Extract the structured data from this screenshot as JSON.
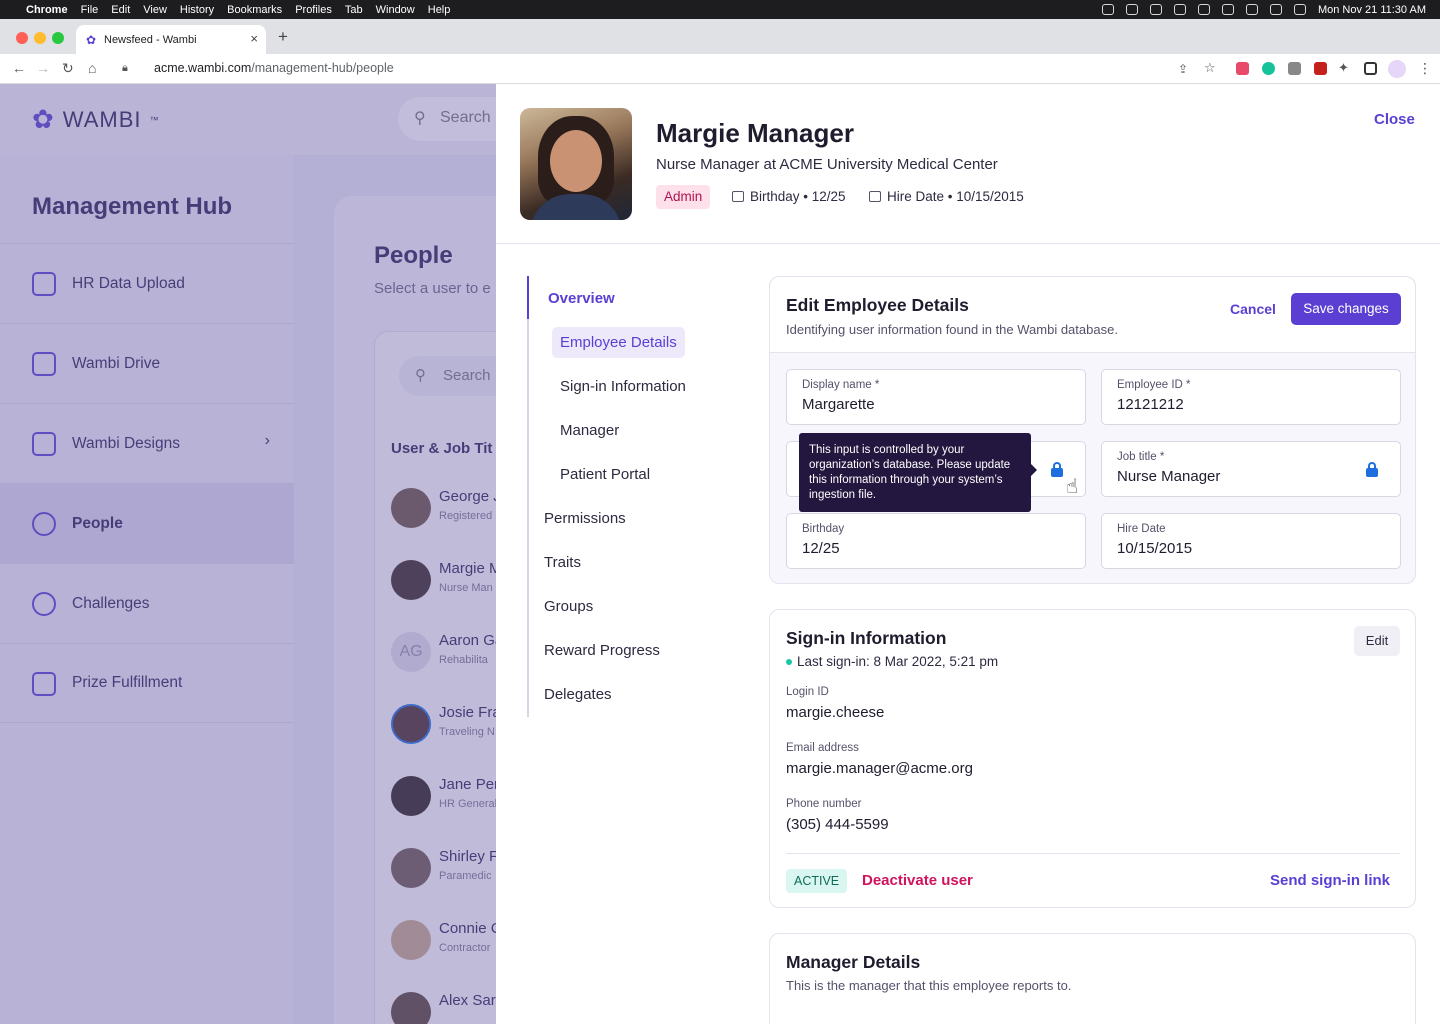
{
  "menubar": {
    "apple": "",
    "items": [
      "Chrome",
      "File",
      "Edit",
      "View",
      "History",
      "Bookmarks",
      "Profiles",
      "Tab",
      "Window",
      "Help"
    ],
    "datetime": "Mon Nov 21  11:30 AM"
  },
  "browser": {
    "tab_title": "Newsfeed - Wambi",
    "url_host": "acme.wambi.com",
    "url_path": "/management-hub/people"
  },
  "app": {
    "logo": "WAMBI",
    "logo_tm": "™",
    "search_placeholder": "Search",
    "sidebar": {
      "title": "Management Hub",
      "items": [
        {
          "label": "HR Data Upload",
          "icon": "upload-file-icon"
        },
        {
          "label": "Wambi Drive",
          "icon": "folder-icon"
        },
        {
          "label": "Wambi Designs",
          "icon": "image-icon"
        },
        {
          "label": "People",
          "icon": "user-add-icon"
        },
        {
          "label": "Challenges",
          "icon": "badge-icon"
        },
        {
          "label": "Prize Fulfillment",
          "icon": "gift-icon"
        }
      ]
    },
    "people": {
      "title": "People",
      "subtitle": "Select a user to e",
      "list_search": "Search",
      "column_header": "User & Job Tit",
      "rows": [
        {
          "name": "George J",
          "job": "Registered"
        },
        {
          "name": "Margie M",
          "job": "Nurse Man"
        },
        {
          "name": "Aaron Ga",
          "job": "Rehabilita",
          "initials": "AG"
        },
        {
          "name": "Josie Fra",
          "job": "Traveling N"
        },
        {
          "name": "Jane Per",
          "job": "HR General"
        },
        {
          "name": "Shirley F",
          "job": "Paramedic"
        },
        {
          "name": "Connie C",
          "job": "Contractor"
        },
        {
          "name": "Alex Sar",
          "job": ""
        }
      ]
    }
  },
  "panel": {
    "name": "Margie Manager",
    "role": "Nurse Manager at ACME University Medical Center",
    "badge": "Admin",
    "birthday": "Birthday • 12/25",
    "hire_date": "Hire Date • 10/15/2015",
    "close": "Close",
    "nav": {
      "overview": "Overview",
      "sub": [
        "Employee Details",
        "Sign-in Information",
        "Manager",
        "Patient Portal"
      ],
      "main": [
        "Permissions",
        "Traits",
        "Groups",
        "Reward Progress",
        "Delegates"
      ]
    },
    "edit_card": {
      "title": "Edit Employee Details",
      "subtitle": "Identifying user information found in the Wambi database.",
      "cancel": "Cancel",
      "save": "Save changes",
      "fields": {
        "display_name": {
          "label": "Display name *",
          "value": "Margarette"
        },
        "employee_id": {
          "label": "Employee ID *",
          "value": "12121212"
        },
        "job_title": {
          "label": "Job title *",
          "value": "Nurse Manager"
        },
        "birthday": {
          "label": "Birthday",
          "value": "12/25"
        },
        "hire_date": {
          "label": "Hire Date",
          "value": "10/15/2015"
        }
      },
      "tooltip": "This input is controlled by your organization’s database. Please update this information through your system’s ingestion file."
    },
    "signin_card": {
      "title": "Sign-in Information",
      "edit": "Edit",
      "last_signin": "Last sign-in: 8 Mar 2022, 5:21 pm",
      "login_label": "Login ID",
      "login_value": "margie.cheese",
      "email_label": "Email address",
      "email_value": "margie.manager@acme.org",
      "phone_label": "Phone number",
      "phone_value": "(305) 444-5599",
      "status": "ACTIVE",
      "deactivate": "Deactivate user",
      "send_link": "Send sign-in link"
    },
    "manager_card": {
      "title": "Manager Details",
      "subtitle": "This is the manager that this employee reports to."
    }
  }
}
